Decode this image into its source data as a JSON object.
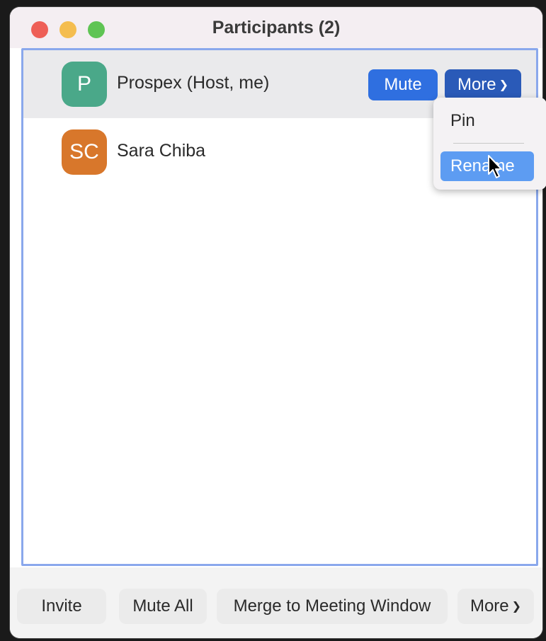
{
  "window": {
    "title": "Participants (2)"
  },
  "participants": [
    {
      "initials": "P",
      "name": "Prospex (Host, me)",
      "avatar_color": "#4aa889"
    },
    {
      "initials": "SC",
      "name": "Sara Chiba",
      "avatar_color": "#d8772b"
    }
  ],
  "row_actions": {
    "mute_label": "Mute",
    "more_label": "More"
  },
  "more_menu": {
    "items": [
      "Pin",
      "Rename"
    ],
    "highlighted": "Rename"
  },
  "bottom_toolbar": {
    "invite_label": "Invite",
    "mute_all_label": "Mute All",
    "merge_label": "Merge to Meeting Window",
    "more_label": "More"
  },
  "colors": {
    "accent": "#2f6fe0",
    "selection_border": "#8aa8ec",
    "menu_highlight": "#5d9cf2"
  }
}
